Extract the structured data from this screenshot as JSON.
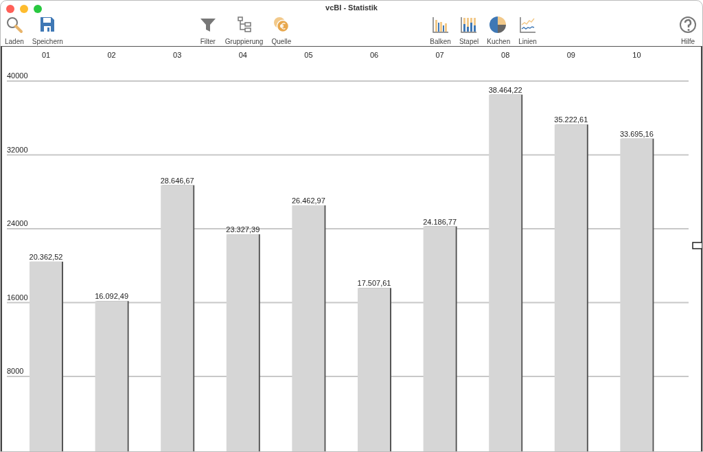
{
  "window": {
    "title": "vcBI - Statistik"
  },
  "toolbar": {
    "groups": [
      [
        {
          "label": "Laden"
        },
        {
          "label": "Speichern"
        }
      ],
      [
        {
          "label": "Filter"
        },
        {
          "label": "Gruppierung"
        },
        {
          "label": "Quelle"
        }
      ],
      [
        {
          "label": "Balken"
        },
        {
          "label": "Stapel"
        },
        {
          "label": "Kuchen"
        },
        {
          "label": "Linien"
        }
      ],
      [
        {
          "label": "Hilfe"
        }
      ]
    ]
  },
  "chart": {
    "chart_data": {
      "type": "bar",
      "categories": [
        "01",
        "02",
        "03",
        "04",
        "05",
        "06",
        "07",
        "08",
        "09",
        "10"
      ],
      "series": [
        {
          "color": "#d6d6d6",
          "values": [
            20362.52,
            16092.49,
            28646.67,
            23327.39,
            26462.97,
            17507.61,
            24186.77,
            38464.22,
            35222.61,
            33695.16
          ]
        }
      ],
      "value_labels": [
        "20.362,52",
        "16.092,49",
        "28.646,67",
        "23.327,39",
        "26.462,97",
        "17.507,61",
        "24.186,77",
        "38.464,22",
        "35.222,61",
        "33.695,16"
      ],
      "ylim": [
        0,
        43800
      ],
      "yticks": [
        8000,
        16000,
        24000,
        32000,
        40000
      ],
      "grid": true
    }
  }
}
